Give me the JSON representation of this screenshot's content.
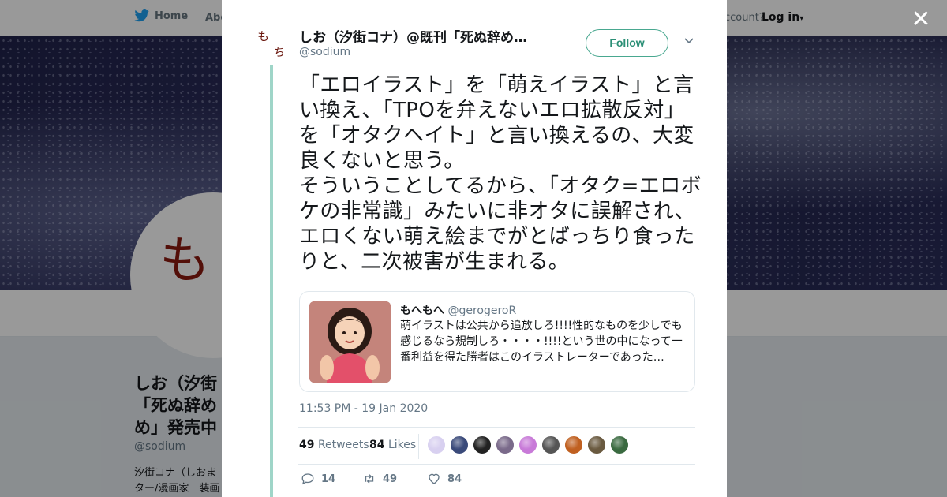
{
  "background": {
    "nav": {
      "home_label": "Home",
      "about_label": "Abo",
      "account_text": "ccount?",
      "login_label": "Log in"
    },
    "profile": {
      "avatar_char": "も",
      "name": "しお（汐街コナ）@既刊「死ぬ辞め」発売中",
      "name_visible": "しお（汐街 「死ぬ辞め め」発売中",
      "handle": "@sodium",
      "bio": "汐街コナ（しおま ター/漫画家　装画"
    }
  },
  "modal": {
    "close_label": "✕",
    "author": {
      "avatar_chars": [
        "も",
        "ち"
      ],
      "name": "しお（汐街コナ）@既刊「死ぬ辞め…",
      "handle": "@sodium",
      "follow_label": "Follow",
      "menu_caret": "⌄"
    },
    "tweet": {
      "text": "「エロイラスト」を「萌えイラスト」と言い換え、「TPOを弁えないエロ拡散反対」を「オタクヘイト」と言い換えるの、大変良くないと思う。\nそういうことしてるから、「オタク=エロボケの非常識」みたいに非オタに誤解され、エロくない萌え絵までがとばっちり食ったりと、二次被害が生まれる。",
      "timestamp": "11:53 PM - 19 Jan 2020"
    },
    "quote": {
      "name": "もへもへ",
      "handle": "@gerogeroR",
      "text": "萌イラストは公共から追放しろ!!!!性的なものを少しでも感じるなら規制しろ・・・・!!!!という世の中になって一番利益を得た勝者はこのイラストレーターであった…"
    },
    "stats": {
      "retweets_count": "49",
      "retweets_label": "Retweets",
      "likes_count": "84",
      "likes_label": "Likes",
      "liker_colors": [
        "#d8d0f0",
        "#3a4a7a",
        "#222222",
        "#7a6a8a",
        "#c87ad8",
        "#555555",
        "#c06020",
        "#6a5a40",
        "#3a6a40"
      ]
    },
    "actions": {
      "reply_count": "14",
      "retweet_count": "49",
      "like_count": "84"
    }
  }
}
